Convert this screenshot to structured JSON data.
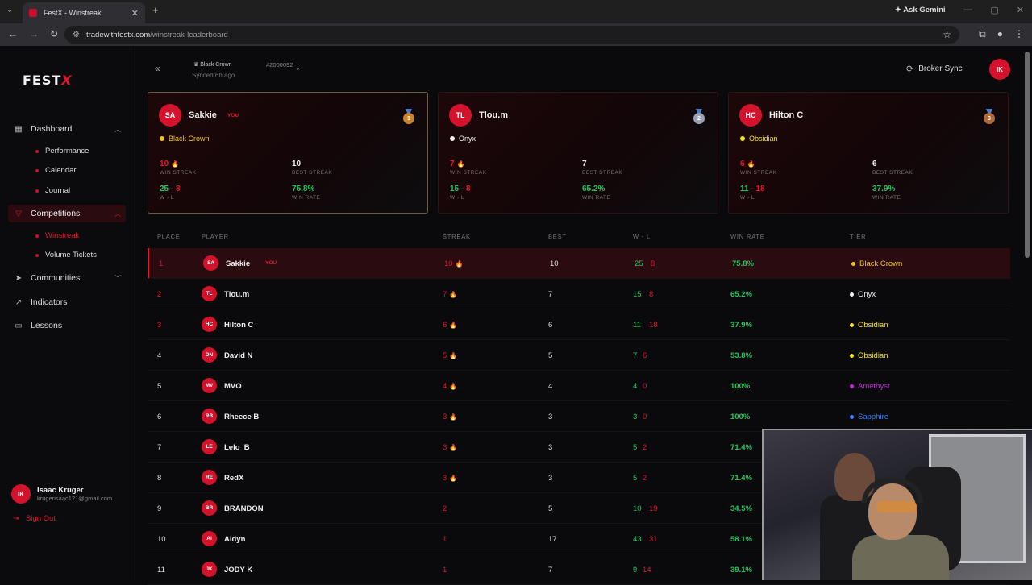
{
  "browser": {
    "tab_title": "FestX - Winstreak",
    "url_domain": "tradewithfestx.com",
    "url_path": "/winstreak-leaderboard",
    "ask_gemini": "Ask Gemini"
  },
  "sidebar": {
    "logo_main": "FEST",
    "logo_accent": "X",
    "dashboard": "Dashboard",
    "dashboard_children": [
      "Performance",
      "Calendar",
      "Journal"
    ],
    "competitions": "Competitions",
    "competitions_children": [
      "Winstreak",
      "Volume Tickets"
    ],
    "communities": "Communities",
    "indicators": "Indicators",
    "lessons": "Lessons",
    "user_initials": "IK",
    "user_name": "Isaac Kruger",
    "user_email": "krugerisaac121@gmail.com",
    "sign_out": "Sign Out"
  },
  "topbar": {
    "account_name": "Black Crown",
    "account_id": "#2000092",
    "synced": "Synced 6h ago",
    "broker_sync": "Broker Sync",
    "avatar_initials": "IK"
  },
  "podium": [
    {
      "initials": "SA",
      "name": "Sakkie",
      "you": "YOU",
      "tier": "Black Crown",
      "tier_color": "#f5c518",
      "rank": "1",
      "medal_color": "#c8842a",
      "win_streak": "10",
      "best_streak": "10",
      "wl_w": "25",
      "wl_l": "8",
      "win_rate": "75.8%"
    },
    {
      "initials": "TL",
      "name": "Tlou.m",
      "you": "",
      "tier": "Onyx",
      "tier_color": "#f1f1f1",
      "rank": "2",
      "medal_color": "#9aa3b5",
      "win_streak": "7",
      "best_streak": "7",
      "wl_w": "15",
      "wl_l": "8",
      "win_rate": "65.2%"
    },
    {
      "initials": "HC",
      "name": "Hilton C",
      "you": "",
      "tier": "Obsidian",
      "tier_color": "#f5e51b",
      "rank": "3",
      "medal_color": "#b06a3a",
      "win_streak": "6",
      "best_streak": "6",
      "wl_w": "11",
      "wl_l": "18",
      "win_rate": "37.9%"
    }
  ],
  "labels": {
    "win_streak": "WIN STREAK",
    "best_streak": "BEST STREAK",
    "wl": "W - L",
    "win_rate": "WIN RATE"
  },
  "table": {
    "headers": {
      "place": "PLACE",
      "player": "PLAYER",
      "streak": "STREAK",
      "best": "BEST",
      "wl": "W - L",
      "win_rate": "WIN RATE",
      "tier": "TIER"
    },
    "rows": [
      {
        "place": "1",
        "initials": "SA",
        "name": "Sakkie",
        "you": "YOU",
        "streak": "10",
        "best": "10",
        "w": "25",
        "l": "8",
        "win_rate": "75.8%",
        "tier": "Black Crown",
        "tier_color": "#f5c518"
      },
      {
        "place": "2",
        "initials": "TL",
        "name": "Tlou.m",
        "you": "",
        "streak": "7",
        "best": "7",
        "w": "15",
        "l": "8",
        "win_rate": "65.2%",
        "tier": "Onyx",
        "tier_color": "#f1f1f1"
      },
      {
        "place": "3",
        "initials": "HC",
        "name": "Hilton C",
        "you": "",
        "streak": "6",
        "best": "6",
        "w": "11",
        "l": "18",
        "win_rate": "37.9%",
        "tier": "Obsidian",
        "tier_color": "#f5e51b"
      },
      {
        "place": "4",
        "initials": "DN",
        "name": "David N",
        "you": "",
        "streak": "5",
        "best": "5",
        "w": "7",
        "l": "6",
        "win_rate": "53.8%",
        "tier": "Obsidian",
        "tier_color": "#f5e51b"
      },
      {
        "place": "5",
        "initials": "MV",
        "name": "MVO",
        "you": "",
        "streak": "4",
        "best": "4",
        "w": "4",
        "l": "0",
        "win_rate": "100%",
        "tier": "Amethyst",
        "tier_color": "#c02ad6"
      },
      {
        "place": "6",
        "initials": "RB",
        "name": "Rheece B",
        "you": "",
        "streak": "3",
        "best": "3",
        "w": "3",
        "l": "0",
        "win_rate": "100%",
        "tier": "Sapphire",
        "tier_color": "#3b82f6"
      },
      {
        "place": "7",
        "initials": "LE",
        "name": "Lelo_B",
        "you": "",
        "streak": "3",
        "best": "3",
        "w": "5",
        "l": "2",
        "win_rate": "71.4%",
        "tier": "",
        "tier_color": "#888"
      },
      {
        "place": "8",
        "initials": "RE",
        "name": "RedX",
        "you": "",
        "streak": "3",
        "best": "3",
        "w": "5",
        "l": "2",
        "win_rate": "71.4%",
        "tier": "",
        "tier_color": "#888"
      },
      {
        "place": "9",
        "initials": "BR",
        "name": "BRANDON",
        "you": "",
        "streak": "2",
        "best": "5",
        "w": "10",
        "l": "19",
        "win_rate": "34.5%",
        "tier": "",
        "tier_color": "#888"
      },
      {
        "place": "10",
        "initials": "AI",
        "name": "Aidyn",
        "you": "",
        "streak": "1",
        "best": "17",
        "w": "43",
        "l": "31",
        "win_rate": "58.1%",
        "tier": "",
        "tier_color": "#888"
      },
      {
        "place": "11",
        "initials": "JK",
        "name": "JODY K",
        "you": "",
        "streak": "1",
        "best": "7",
        "w": "9",
        "l": "14",
        "win_rate": "39.1%",
        "tier": "",
        "tier_color": "#888"
      }
    ]
  }
}
